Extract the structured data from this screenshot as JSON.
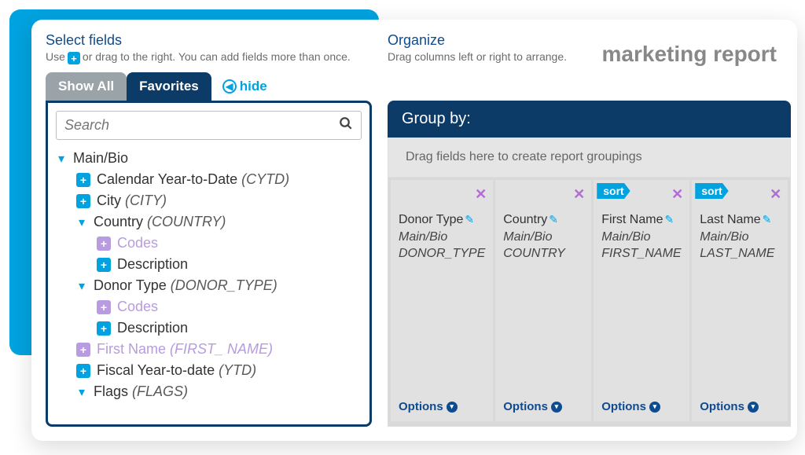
{
  "report_title": "marketing report",
  "select": {
    "title": "Select fields",
    "sub_pre": "Use",
    "sub_post": "or drag to the right. You can add fields more than once."
  },
  "tabs": {
    "show_all": "Show All",
    "favorites": "Favorites",
    "hide": "hide"
  },
  "search": {
    "placeholder": "Search"
  },
  "tree": {
    "main_bio": "Main/Bio",
    "cytd_label": "Calendar Year-to-Date",
    "cytd_api": "(CYTD)",
    "city_label": "City",
    "city_api": "(CITY)",
    "country_label": "Country",
    "country_api": "(COUNTRY)",
    "codes": "Codes",
    "description": "Description",
    "donor_type_label": "Donor Type",
    "donor_type_api": "(DONOR_TYPE)",
    "first_name_label": "First Name",
    "first_name_api": "(FIRST_ NAME)",
    "ytd_label": "Fiscal Year-to-date",
    "ytd_api": "(YTD)",
    "flags_label": "Flags",
    "flags_api": "(FLAGS)"
  },
  "organize": {
    "title": "Organize",
    "sub": "Drag columns left or right to arrange."
  },
  "group_by": {
    "header": "Group by:",
    "drop_hint": "Drag fields here to create report groupings"
  },
  "sort_label": "sort",
  "options_label": "Options",
  "columns": [
    {
      "title": "Donor Type",
      "path": "Main/Bio",
      "api": "DONOR_TYPE",
      "sort": false
    },
    {
      "title": "Country",
      "path": "Main/Bio",
      "api": "COUNTRY",
      "sort": false
    },
    {
      "title": "First Name",
      "path": "Main/Bio",
      "api": "FIRST_NAME",
      "sort": true
    },
    {
      "title": "Last Name",
      "path": "Main/Bio",
      "api": "LAST_NAME",
      "sort": true
    }
  ]
}
